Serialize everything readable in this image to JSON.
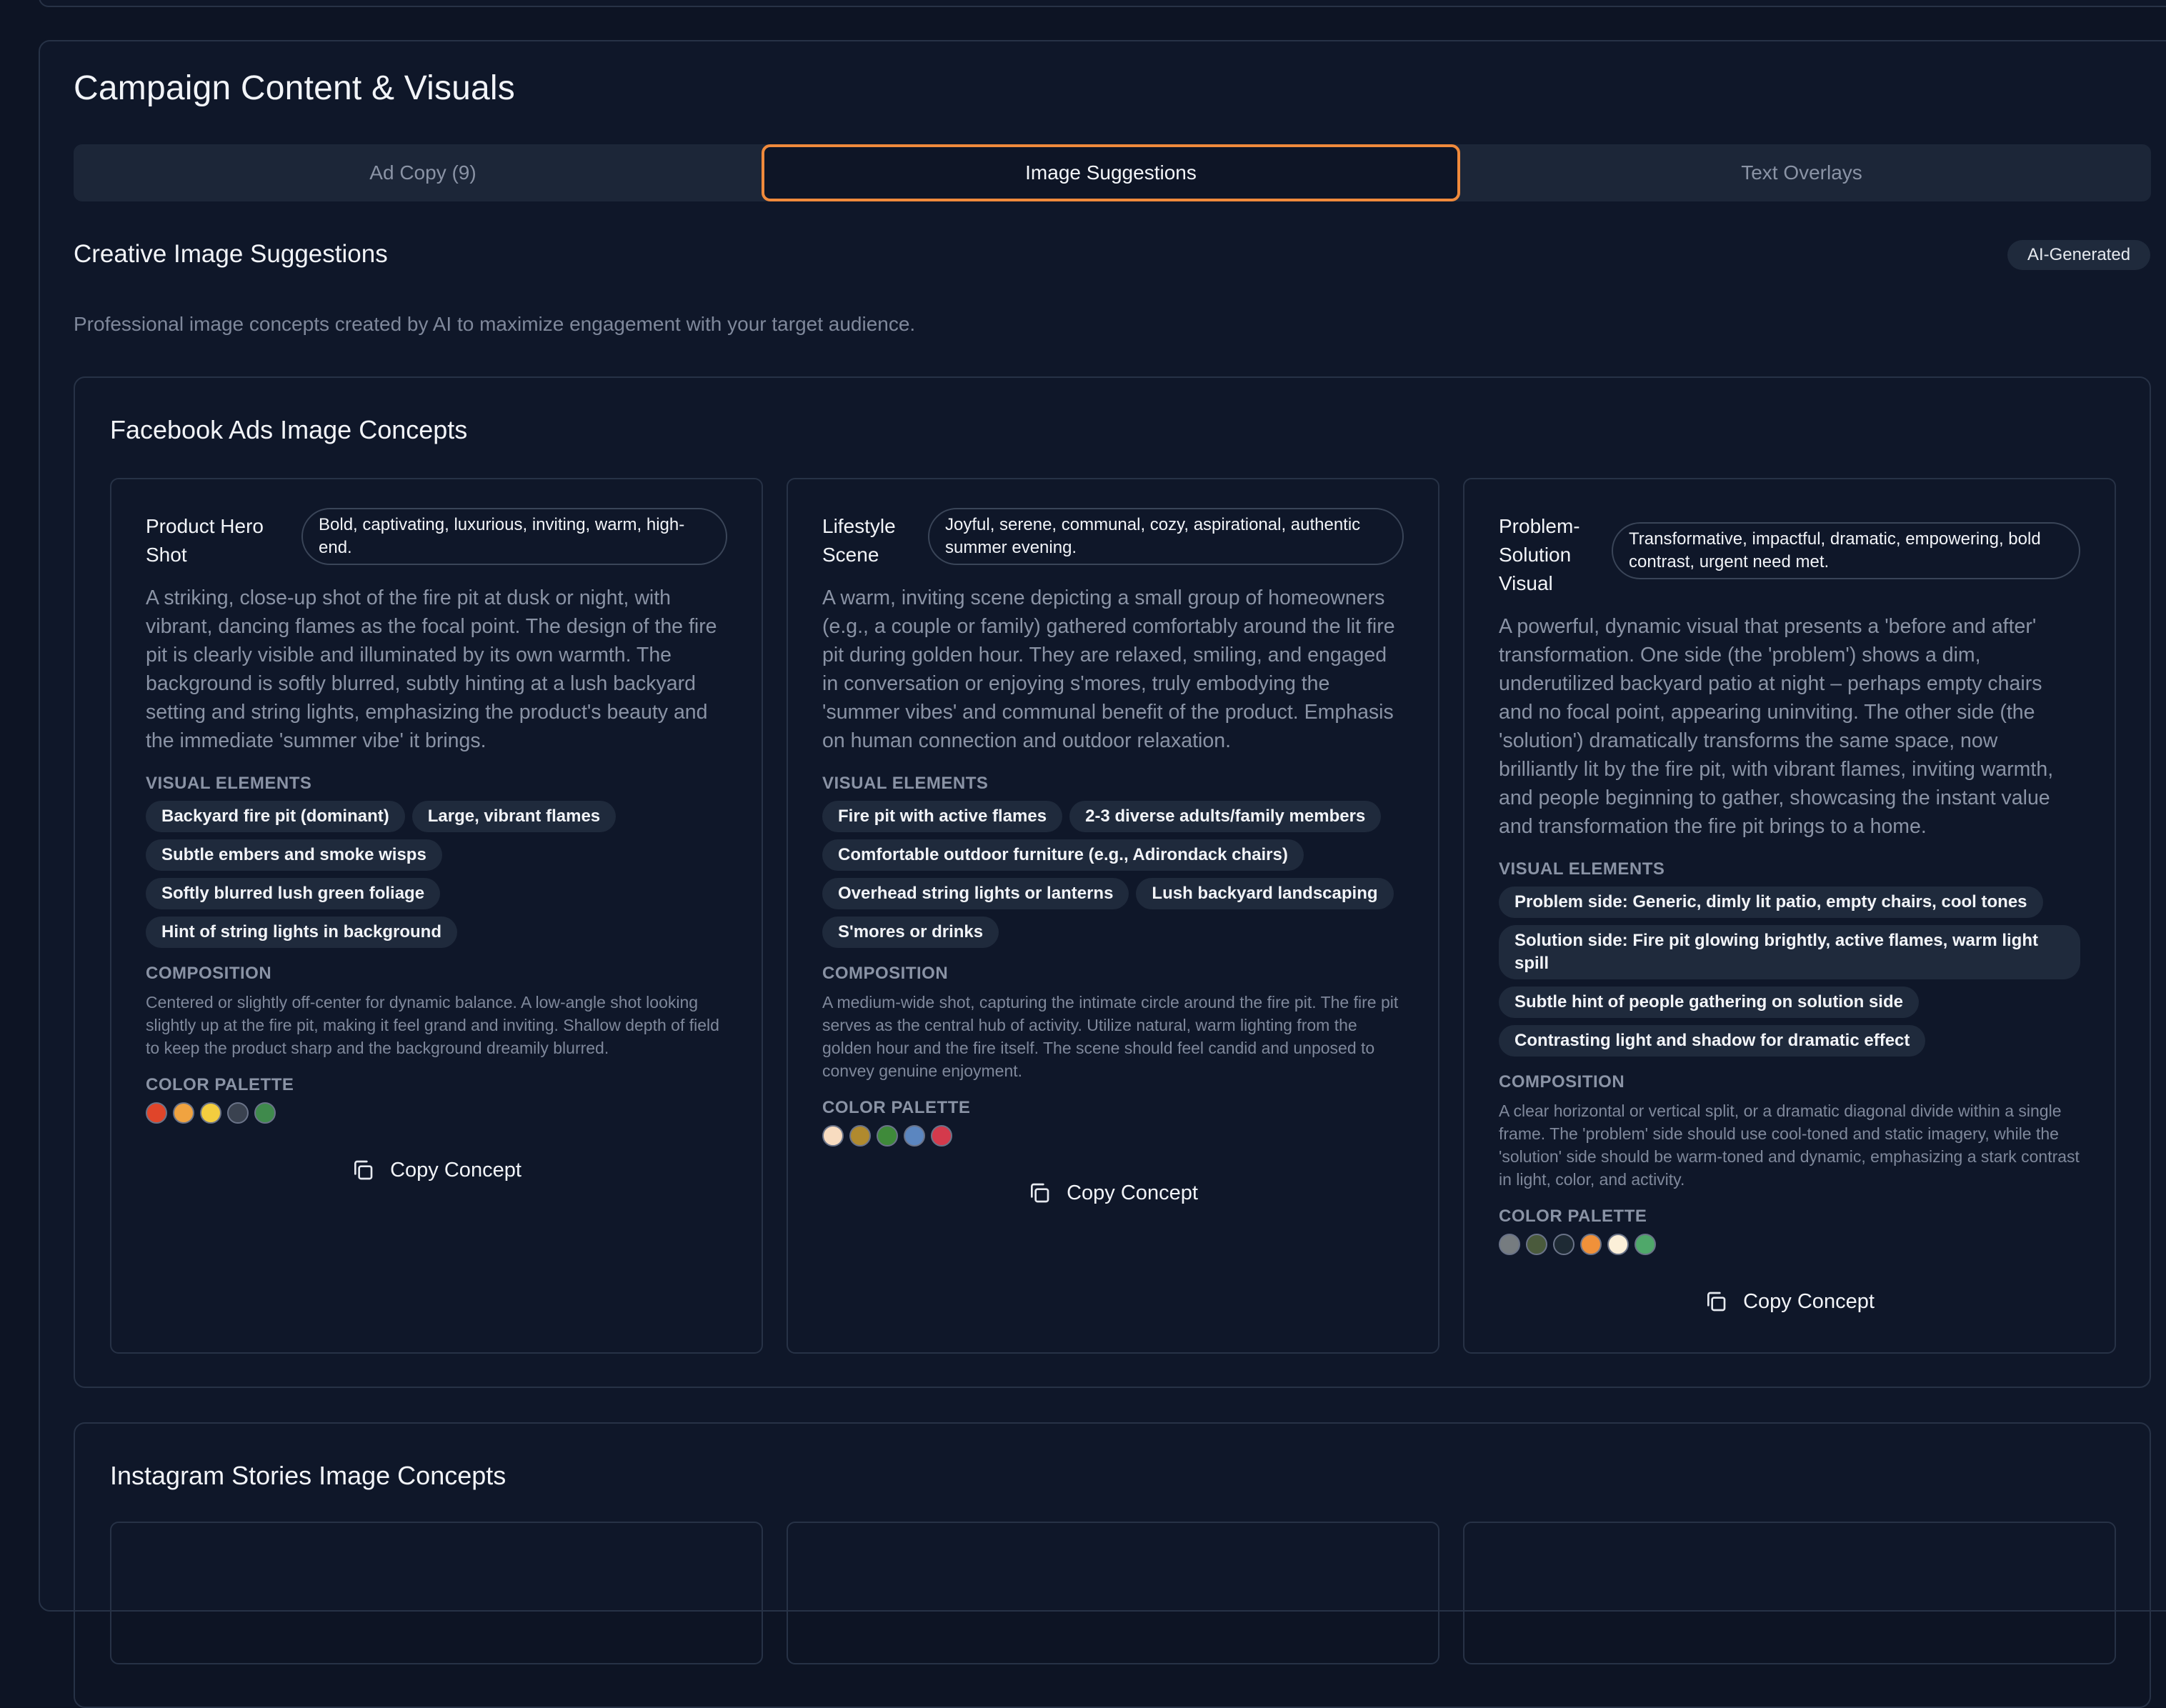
{
  "page": {
    "title": "Campaign Content & Visuals",
    "tabs": [
      {
        "label": "Ad Copy (9)",
        "active": false
      },
      {
        "label": "Image Suggestions",
        "active": true
      },
      {
        "label": "Text Overlays",
        "active": false
      }
    ]
  },
  "section": {
    "title": "Creative Image Suggestions",
    "badge": "AI-Generated",
    "description": "Professional image concepts created by AI to maximize engagement with your target audience."
  },
  "labels": {
    "visual_elements": "VISUAL ELEMENTS",
    "composition": "COMPOSITION",
    "color_palette": "COLOR PALETTE",
    "copy": "Copy Concept"
  },
  "groups": [
    {
      "title": "Facebook Ads Image Concepts",
      "cards": [
        {
          "title": "Product Hero Shot",
          "mood": "Bold, captivating, luxurious, inviting, warm, high-end.",
          "description": "A striking, close-up shot of the fire pit at dusk or night, with vibrant, dancing flames as the focal point. The design of the fire pit is clearly visible and illuminated by its own warmth. The background is softly blurred, subtly hinting at a lush backyard setting and string lights, emphasizing the product's beauty and the immediate 'summer vibe' it brings.",
          "elements": [
            "Backyard fire pit (dominant)",
            "Large, vibrant flames",
            "Subtle embers and smoke wisps",
            "Softly blurred lush green foliage",
            "Hint of string lights in background"
          ],
          "composition": "Centered or slightly off-center for dynamic balance. A low-angle shot looking slightly up at the fire pit, making it feel grand and inviting. Shallow depth of field to keep the product sharp and the background dreamily blurred.",
          "palette": [
            "#e0452a",
            "#f0a340",
            "#f3cd3f",
            "#3a4250",
            "#3f8a4c"
          ]
        },
        {
          "title": "Lifestyle Scene",
          "mood": "Joyful, serene, communal, cozy, aspirational, authentic summer evening.",
          "description": "A warm, inviting scene depicting a small group of homeowners (e.g., a couple or family) gathered comfortably around the lit fire pit during golden hour. They are relaxed, smiling, and engaged in conversation or enjoying s'mores, truly embodying the 'summer vibes' and communal benefit of the product. Emphasis on human connection and outdoor relaxation.",
          "elements": [
            "Fire pit with active flames",
            "2-3 diverse adults/family members",
            "Comfortable outdoor furniture (e.g., Adirondack chairs)",
            "Overhead string lights or lanterns",
            "Lush backyard landscaping",
            "S'mores or drinks"
          ],
          "composition": "A medium-wide shot, capturing the intimate circle around the fire pit. The fire pit serves as the central hub of activity. Utilize natural, warm lighting from the golden hour and the fire itself. The scene should feel candid and unposed to convey genuine enjoyment.",
          "palette": [
            "#f8dcc0",
            "#b08a2e",
            "#3f8a3a",
            "#5b86c0",
            "#d43a4c"
          ]
        },
        {
          "title": "Problem-Solution Visual",
          "mood": "Transformative, impactful, dramatic, empowering, bold contrast, urgent need met.",
          "description": "A powerful, dynamic visual that presents a 'before and after' transformation. One side (the 'problem') shows a dim, underutilized backyard patio at night – perhaps empty chairs and no focal point, appearing uninviting. The other side (the 'solution') dramatically transforms the same space, now brilliantly lit by the fire pit, with vibrant flames, inviting warmth, and people beginning to gather, showcasing the instant value and transformation the fire pit brings to a home.",
          "elements": [
            "Problem side: Generic, dimly lit patio, empty chairs, cool tones",
            "Solution side: Fire pit glowing brightly, active flames, warm light spill",
            "Subtle hint of people gathering on solution side",
            "Contrasting light and shadow for dramatic effect"
          ],
          "composition": "A clear horizontal or vertical split, or a dramatic diagonal divide within a single frame. The 'problem' side should use cool-toned and static imagery, while the 'solution' side should be warm-toned and dynamic, emphasizing a stark contrast in light, color, and activity.",
          "palette": [
            "#767c80",
            "#4a5a3c",
            "#1e2a34",
            "#f0913a",
            "#fbefd8",
            "#4fa86a"
          ]
        }
      ]
    },
    {
      "title": "Instagram Stories Image Concepts"
    }
  ]
}
